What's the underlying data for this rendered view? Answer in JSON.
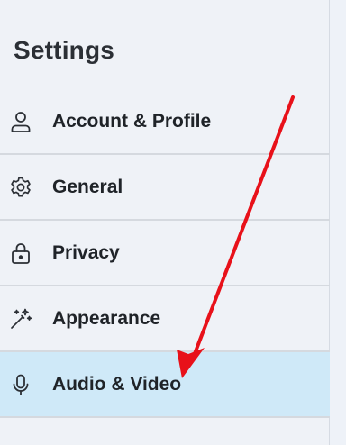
{
  "settings": {
    "title": "Settings",
    "items": [
      {
        "label": "Account & Profile",
        "icon": "user-icon",
        "active": false
      },
      {
        "label": "General",
        "icon": "gear-icon",
        "active": false
      },
      {
        "label": "Privacy",
        "icon": "lock-icon",
        "active": false
      },
      {
        "label": "Appearance",
        "icon": "magic-wand-icon",
        "active": false
      },
      {
        "label": "Audio & Video",
        "icon": "microphone-icon",
        "active": true
      }
    ]
  },
  "colors": {
    "active_background": "#cfe9f8",
    "annotation_arrow": "#e8111a"
  }
}
